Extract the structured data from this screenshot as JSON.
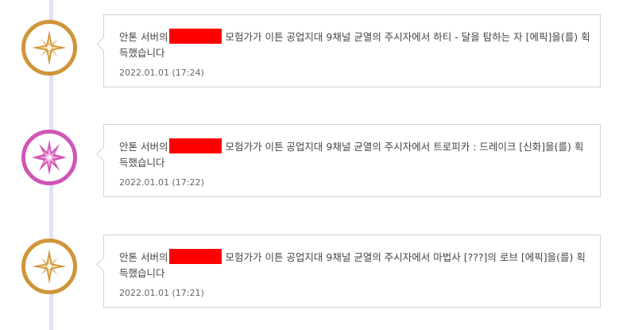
{
  "colors": {
    "epic": "#d09538",
    "legendary": "#d155b6",
    "redaction": "#ff0000",
    "timeline": "#dfe3f4"
  },
  "entries": [
    {
      "grade_icon": "epic-star-icon",
      "grade_color": "#d09538",
      "msg_prefix": "안톤 서버의",
      "msg_body": "모험가가 이튼 공업지대 9채널 균열의 주시자에서 하티 - 달을 탐하는 자 [에픽]을(를) 획득했습니다",
      "timestamp": "2022.01.01 (17:24)"
    },
    {
      "grade_icon": "legendary-burst-icon",
      "grade_color": "#d155b6",
      "msg_prefix": "안톤 서버의",
      "msg_body": "모험가가 이튼 공업지대 9채널 균열의 주시자에서 트로피카 : 드레이크 [신화]을(를) 획득했습니다",
      "timestamp": "2022.01.01 (17:22)"
    },
    {
      "grade_icon": "epic-star-icon",
      "grade_color": "#d09538",
      "msg_prefix": "안톤 서버의",
      "msg_body": "모험가가 이튼 공업지대 9채널 균열의 주시자에서 마법사 [???]의 로브 [에픽]을(를) 획득했습니다",
      "timestamp": "2022.01.01 (17:21)"
    }
  ]
}
